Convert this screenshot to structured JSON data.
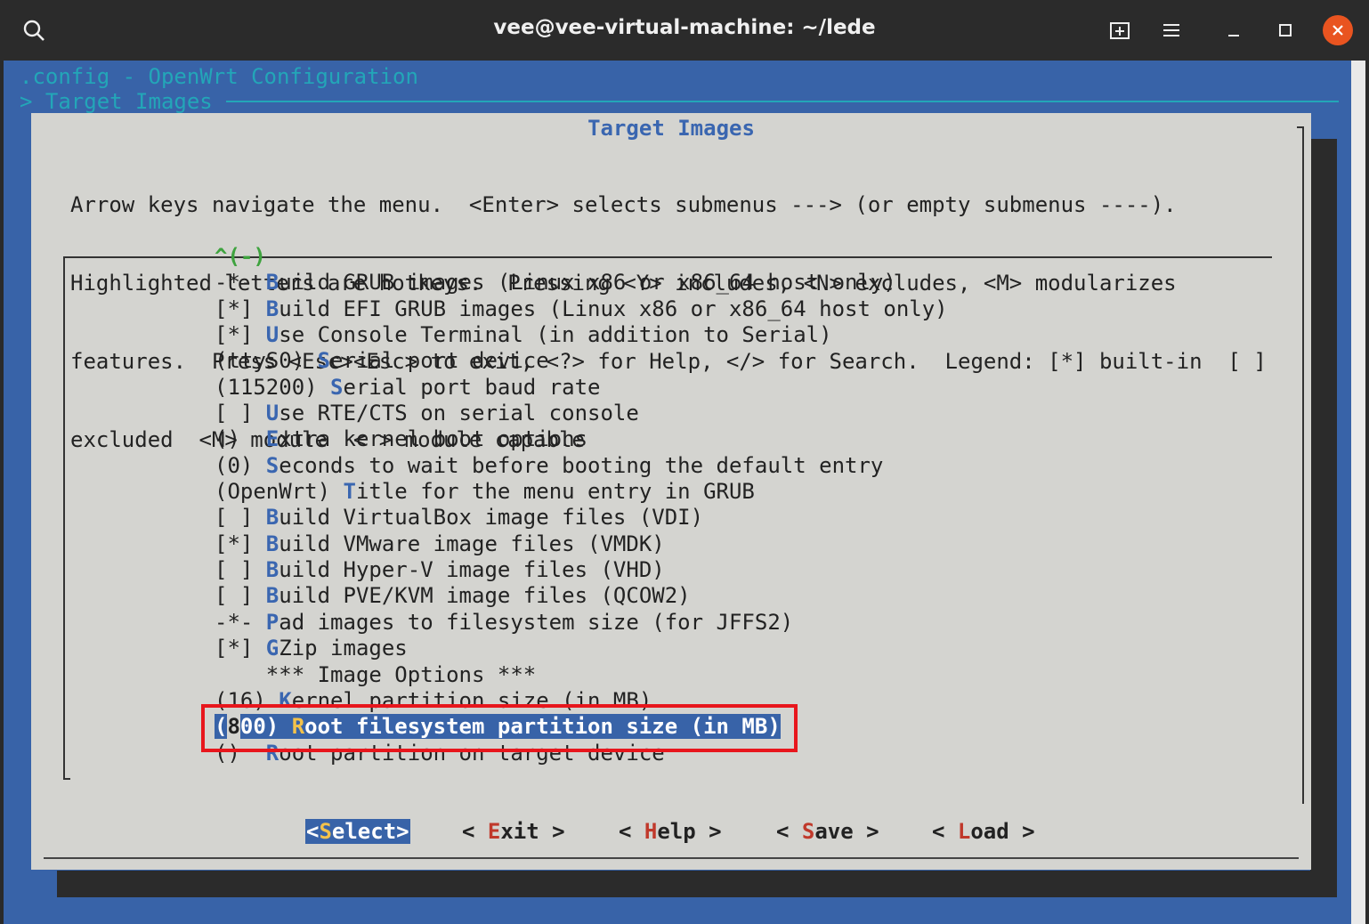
{
  "window": {
    "title": "vee@vee-virtual-machine: ~/lede",
    "icons": [
      "search-icon",
      "new-tab-icon",
      "hamburger-menu-icon",
      "minimize-icon",
      "maximize-icon",
      "close-icon"
    ],
    "close_color": "#e95420"
  },
  "terminal": {
    "header1": ".config - OpenWrt Configuration",
    "header2": "> Target Images",
    "background": "#3863a8"
  },
  "dialog": {
    "title": "Target Images",
    "help_lines": [
      "Arrow keys navigate the menu.  <Enter> selects submenus ---> (or empty submenus ----).",
      "Highlighted letters are hotkeys.  Pressing <Y> includes, <N> excludes, <M> modularizes",
      "features.  Press <Esc><Esc> to exit, <?> for Help, </> for Search.  Legend: [*] built-in  [ ]",
      "excluded  <M> module  < > module capable"
    ],
    "scroll_up": "^(-)",
    "items": [
      {
        "prefix": "-*- ",
        "hotkey": "B",
        "rest": "uild GRUB images (Linux x86 or x86_64 host only)"
      },
      {
        "prefix": "[*] ",
        "hotkey": "B",
        "rest": "uild EFI GRUB images (Linux x86 or x86_64 host only)"
      },
      {
        "prefix": "[*] ",
        "hotkey": "U",
        "rest": "se Console Terminal (in addition to Serial)"
      },
      {
        "prefix": "(ttyS0) ",
        "hotkey": "S",
        "rest": "erial port device"
      },
      {
        "prefix": "(115200) ",
        "hotkey": "S",
        "rest": "erial port baud rate"
      },
      {
        "prefix": "[ ] ",
        "hotkey": "U",
        "rest": "se RTE/CTS on serial console"
      },
      {
        "prefix": "()  ",
        "hotkey": "E",
        "rest": "xtra kernel boot options"
      },
      {
        "prefix": "(0) ",
        "hotkey": "S",
        "rest": "econds to wait before booting the default entry"
      },
      {
        "prefix": "(OpenWrt) ",
        "hotkey": "T",
        "rest": "itle for the menu entry in GRUB"
      },
      {
        "prefix": "[ ] ",
        "hotkey": "B",
        "rest": "uild VirtualBox image files (VDI)"
      },
      {
        "prefix": "[*] ",
        "hotkey": "B",
        "rest": "uild VMware image files (VMDK)"
      },
      {
        "prefix": "[ ] ",
        "hotkey": "B",
        "rest": "uild Hyper-V image files (VHD)"
      },
      {
        "prefix": "[ ] ",
        "hotkey": "B",
        "rest": "uild PVE/KVM image files (QCOW2)"
      },
      {
        "prefix": "-*- ",
        "hotkey": "P",
        "rest": "ad images to filesystem size (for JFFS2)"
      },
      {
        "prefix": "[*] ",
        "hotkey": "G",
        "rest": "Zip images"
      },
      {
        "prefix": "    ",
        "hotkey": "",
        "rest": "*** Image Options ***"
      },
      {
        "prefix": "(16) ",
        "hotkey": "K",
        "rest": "ernel partition size (in MB)"
      }
    ],
    "selected_item": {
      "prefix_open": "(",
      "prefix_cursor": "8",
      "prefix_rest": "00) ",
      "hotkey": "R",
      "rest": "oot filesystem partition size (in MB)"
    },
    "last_item": {
      "prefix": "()  ",
      "hotkey": "R",
      "rest": "oot partition on target device"
    },
    "buttons": [
      {
        "pre": "<",
        "hotkey": "S",
        "rest": "elect",
        "post": ">",
        "active": true
      },
      {
        "pre": "< ",
        "hotkey": "E",
        "rest": "xit",
        "post": " >",
        "active": false
      },
      {
        "pre": "< ",
        "hotkey": "H",
        "rest": "elp",
        "post": " >",
        "active": false
      },
      {
        "pre": "< ",
        "hotkey": "S",
        "rest": "ave",
        "post": " >",
        "active": false
      },
      {
        "pre": "< ",
        "hotkey": "L",
        "rest": "oad",
        "post": " >",
        "active": false
      }
    ]
  },
  "annotation": {
    "color": "#e8161c"
  }
}
